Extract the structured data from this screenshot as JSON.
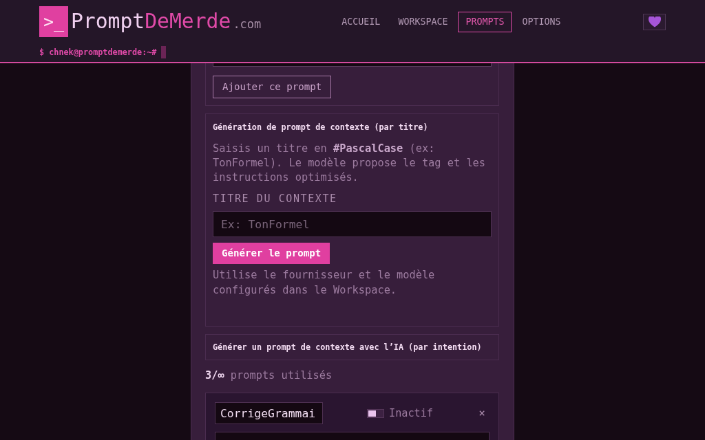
{
  "header": {
    "logo": {
      "mark": ">_",
      "name_first": "Prompt",
      "name_second": "DeMerde",
      "suffix": ".com"
    },
    "nav": [
      {
        "label": "ACCUEIL",
        "selected": false
      },
      {
        "label": "WORKSPACE",
        "selected": false
      },
      {
        "label": "PROMPTS",
        "selected": true
      },
      {
        "label": "OPTIONS",
        "selected": false
      }
    ],
    "prompt_line": "$ chnek@promptdemerde:~#"
  },
  "add_prompt": {
    "button": "Ajouter ce prompt"
  },
  "title_generator": {
    "title": "Génération de prompt de contexte (par titre)",
    "description": "Saisis un titre en **#PascalCase** (ex: TonFormel). Le modèle propose le tag et les instructions optimisés.",
    "field_label": "TITRE DU CONTEXTE",
    "field": {
      "placeholder": "Ex: TonFormel"
    },
    "button": "Générer le prompt",
    "note": "Utilise le fournisseur et le modèle configurés dans le Workspace."
  },
  "intent_generator": {
    "title": "Générer un prompt de contexte avec l’IA (par intention)"
  },
  "usage": "**3/∞** prompts utilisés",
  "prompts": [
    {
      "name": "CorrigeGrammai",
      "active": false,
      "status": "Inactif",
      "close": "×"
    }
  ]
}
